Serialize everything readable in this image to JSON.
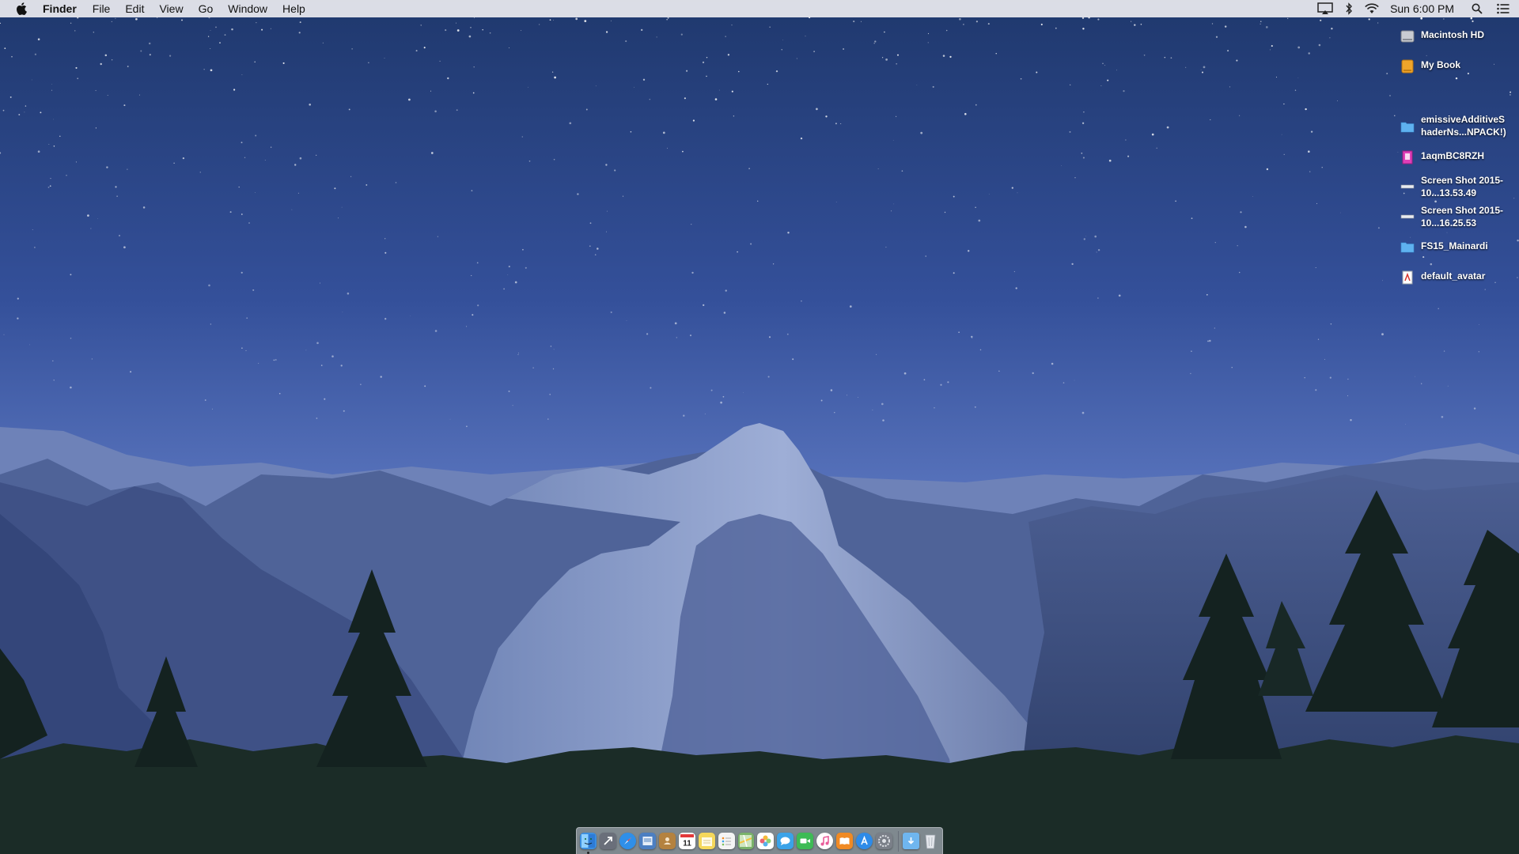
{
  "menubar": {
    "apple_icon": "apple-icon",
    "app_name": "Finder",
    "menus": [
      "File",
      "Edit",
      "View",
      "Go",
      "Window",
      "Help"
    ],
    "status_icons": [
      "airplay-icon",
      "bluetooth-icon",
      "wifi-icon"
    ],
    "clock": "Sun 6:00 PM",
    "right_icons": [
      "spotlight-icon",
      "notification-center-icon"
    ]
  },
  "desktop": {
    "items": [
      {
        "label": "Macintosh HD",
        "icon": "hard-drive-icon"
      },
      {
        "label": "My Book",
        "icon": "external-drive-icon"
      },
      {
        "label": "emissiveAdditiveS haderNs...NPACK!)",
        "icon": "folder-icon"
      },
      {
        "label": "1aqmBC8RZH",
        "icon": "document-icon"
      },
      {
        "label": "Screen Shot 2015-10...13.53.49",
        "icon": "screenshot-icon"
      },
      {
        "label": "Screen Shot 2015-10...16.25.53",
        "icon": "screenshot-icon"
      },
      {
        "label": "FS15_Mainardi",
        "icon": "folder-icon"
      },
      {
        "label": "default_avatar",
        "icon": "pdf-icon"
      }
    ]
  },
  "dock": {
    "apps": [
      {
        "name": "finder-icon",
        "color": "#3b8fe0",
        "running": true
      },
      {
        "name": "launchpad-icon",
        "color": "#6a6f7a"
      },
      {
        "name": "safari-icon",
        "color": "#2f8fe8"
      },
      {
        "name": "mail-icon",
        "color": "#4c7fc2"
      },
      {
        "name": "contacts-icon",
        "color": "#b4823f"
      },
      {
        "name": "calendar-icon",
        "color": "#ffffff"
      },
      {
        "name": "notes-icon",
        "color": "#f5d85b"
      },
      {
        "name": "reminders-icon",
        "color": "#f4f4f4"
      },
      {
        "name": "maps-icon",
        "color": "#7ab36a"
      },
      {
        "name": "photos-icon",
        "color": "#e98a3b"
      },
      {
        "name": "messages-icon",
        "color": "#3aa3e8"
      },
      {
        "name": "facetime-icon",
        "color": "#3dbb55"
      },
      {
        "name": "itunes-icon",
        "color": "#e95e9a"
      },
      {
        "name": "ibooks-icon",
        "color": "#f08a24"
      },
      {
        "name": "app-store-icon",
        "color": "#2e8be8"
      },
      {
        "name": "system-preferences-icon",
        "color": "#7a7f88"
      }
    ],
    "stacks": [
      {
        "name": "downloads-folder-icon",
        "color": "#6fb6ef"
      },
      {
        "name": "trash-icon",
        "color": "#d8dbe0"
      }
    ]
  },
  "colors": {
    "sky_top": "#20396e",
    "sky_bottom": "#6a84c6",
    "mountain": "#56689a",
    "trees": "#16261e"
  }
}
